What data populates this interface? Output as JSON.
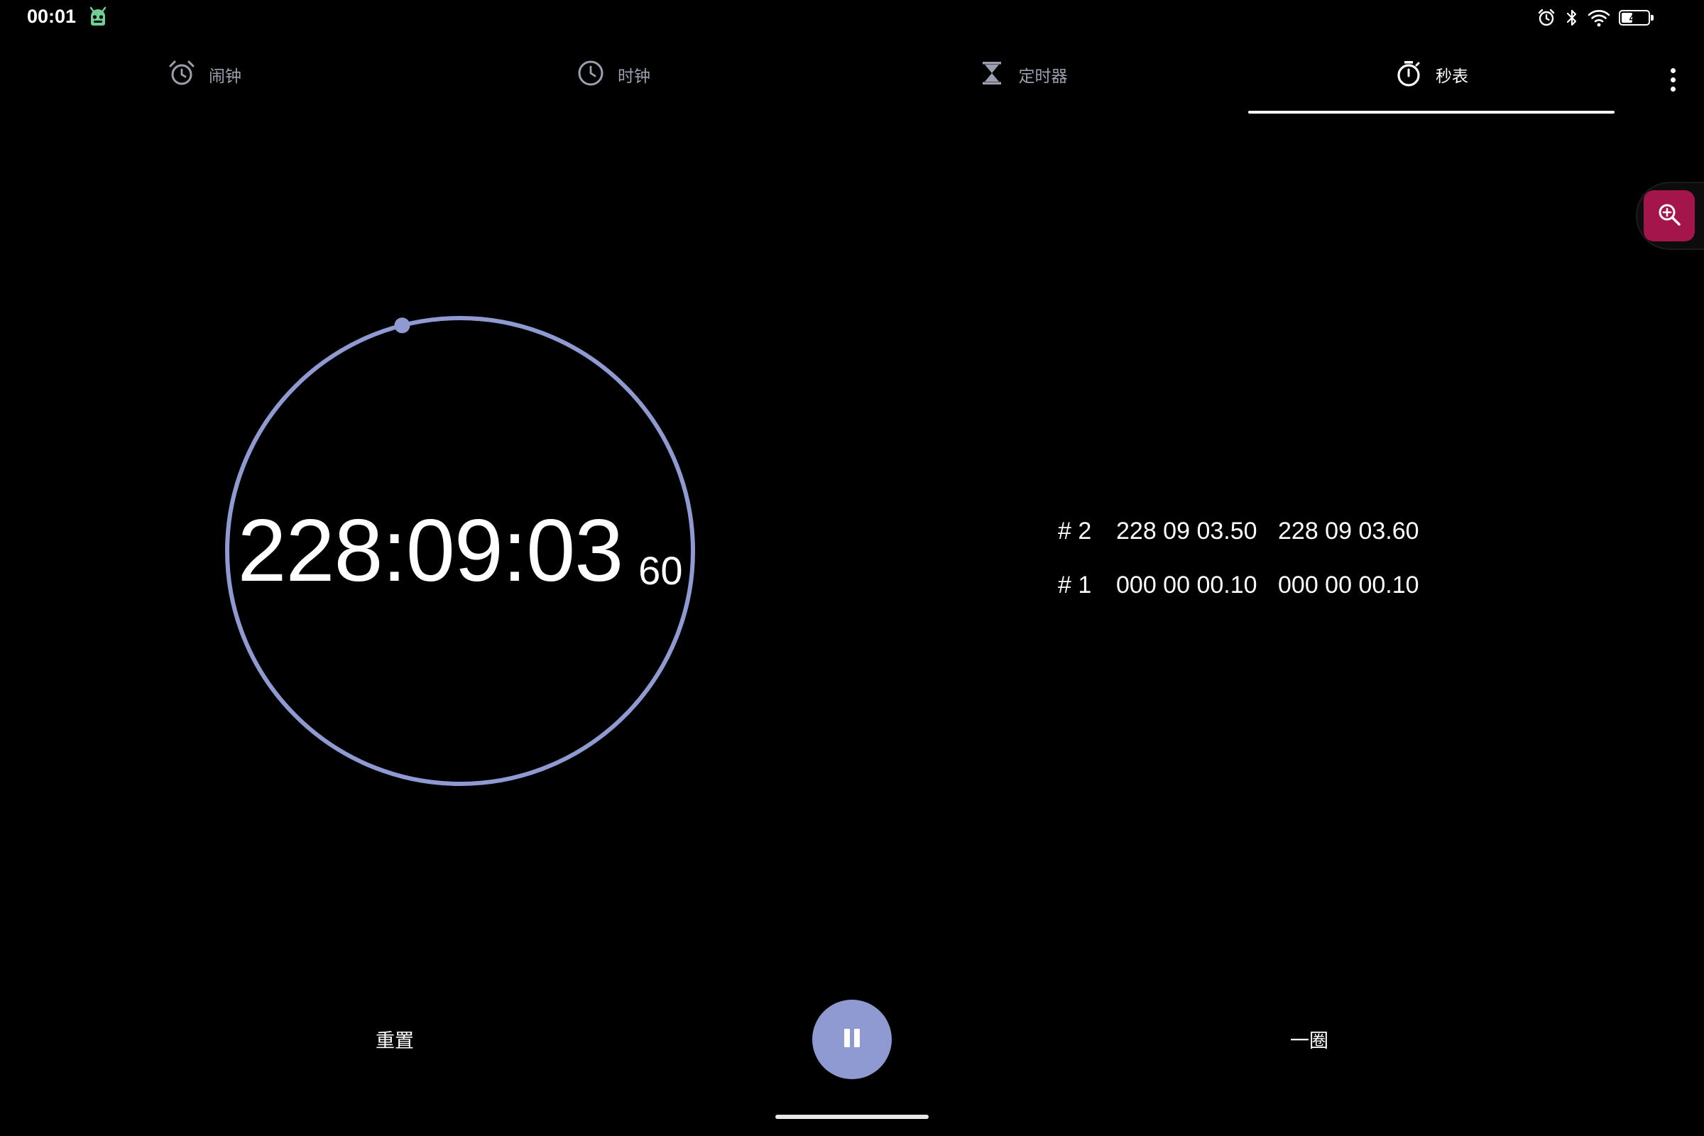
{
  "status_bar": {
    "time": "00:01",
    "app_icon": "android-robot-icon",
    "icons": [
      "alarm-icon",
      "bluetooth-icon",
      "wifi-icon"
    ],
    "battery_level": "42",
    "battery_fraction": 0.42
  },
  "tabs": [
    {
      "label": "闹钟",
      "icon": "alarm-clock-icon",
      "active": false
    },
    {
      "label": "时钟",
      "icon": "clock-icon",
      "active": false
    },
    {
      "label": "定时器",
      "icon": "hourglass-icon",
      "active": false
    },
    {
      "label": "秒表",
      "icon": "stopwatch-icon",
      "active": true
    }
  ],
  "menu_icon": "more-vert-icon",
  "floating": {
    "icon": "zoom-in-icon"
  },
  "stopwatch": {
    "time": "228:09:03",
    "hundredths": "60",
    "progress_fraction": 0.96
  },
  "laps": [
    {
      "number": "# 2",
      "lap_time": "228 09 03.50",
      "total_time": "228 09 03.60"
    },
    {
      "number": "# 1",
      "lap_time": "000 00 00.10",
      "total_time": "000 00 00.10"
    }
  ],
  "controls": {
    "reset_label": "重置",
    "lap_label": "一圈",
    "pause_icon": "pause-icon"
  },
  "colors": {
    "background": "#000000",
    "accent": "#8e9ad1",
    "inactive_text": "#9aa0ae",
    "zoom_button": "#a3154b"
  }
}
